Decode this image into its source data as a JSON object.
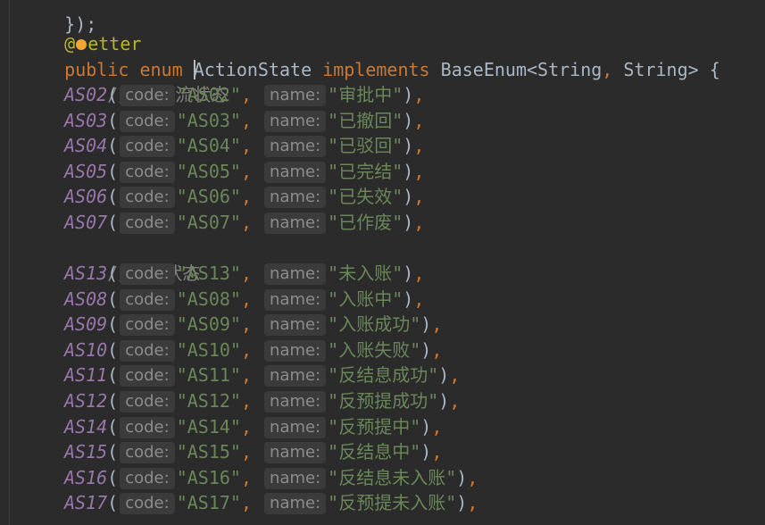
{
  "top_fragment": "});",
  "annotation": {
    "at": "@",
    "rest": "etter"
  },
  "decl": {
    "kw_public": "public",
    "kw_enum": "enum",
    "class_name": "ActionState",
    "kw_implements": "implements",
    "iface": "BaseEnum<String",
    "iface2": " String> {"
  },
  "comment1": "// 工作流状态",
  "comment2": "//做账状态",
  "hint_code": "code:",
  "hint_name": "name:",
  "rows": [
    {
      "name": "AS02",
      "code": "\"AS02\"",
      "label": "\"审批中\""
    },
    {
      "name": "AS03",
      "code": "\"AS03\"",
      "label": "\"已撤回\""
    },
    {
      "name": "AS04",
      "code": "\"AS04\"",
      "label": "\"已驳回\""
    },
    {
      "name": "AS05",
      "code": "\"AS05\"",
      "label": "\"已完结\""
    },
    {
      "name": "AS06",
      "code": "\"AS06\"",
      "label": "\"已失效\""
    },
    {
      "name": "AS07",
      "code": "\"AS07\"",
      "label": "\"已作废\""
    },
    {
      "name": "AS13",
      "code": "\"AS13\"",
      "label": "\"未入账\""
    },
    {
      "name": "AS08",
      "code": "\"AS08\"",
      "label": "\"入账中\""
    },
    {
      "name": "AS09",
      "code": "\"AS09\"",
      "label": "\"入账成功\""
    },
    {
      "name": "AS10",
      "code": "\"AS10\"",
      "label": "\"入账失败\""
    },
    {
      "name": "AS11",
      "code": "\"AS11\"",
      "label": "\"反结息成功\""
    },
    {
      "name": "AS12",
      "code": "\"AS12\"",
      "label": "\"反预提成功\""
    },
    {
      "name": "AS14",
      "code": "\"AS14\"",
      "label": "\"反预提中\""
    },
    {
      "name": "AS15",
      "code": "\"AS15\"",
      "label": "\"反结息中\""
    },
    {
      "name": "AS16",
      "code": "\"AS16\"",
      "label": "\"反结息未入账\""
    },
    {
      "name": "AS17",
      "code": "\"AS17\"",
      "label": "\"反预提未入账\""
    }
  ],
  "colors": {
    "background": "#2b2b2b",
    "keyword": "#cc7832",
    "enum_constant": "#9876aa",
    "string": "#6a8759",
    "comment": "#808080",
    "annotation": "#bbb529"
  },
  "icons": {
    "intention": "lightbulb-icon"
  }
}
